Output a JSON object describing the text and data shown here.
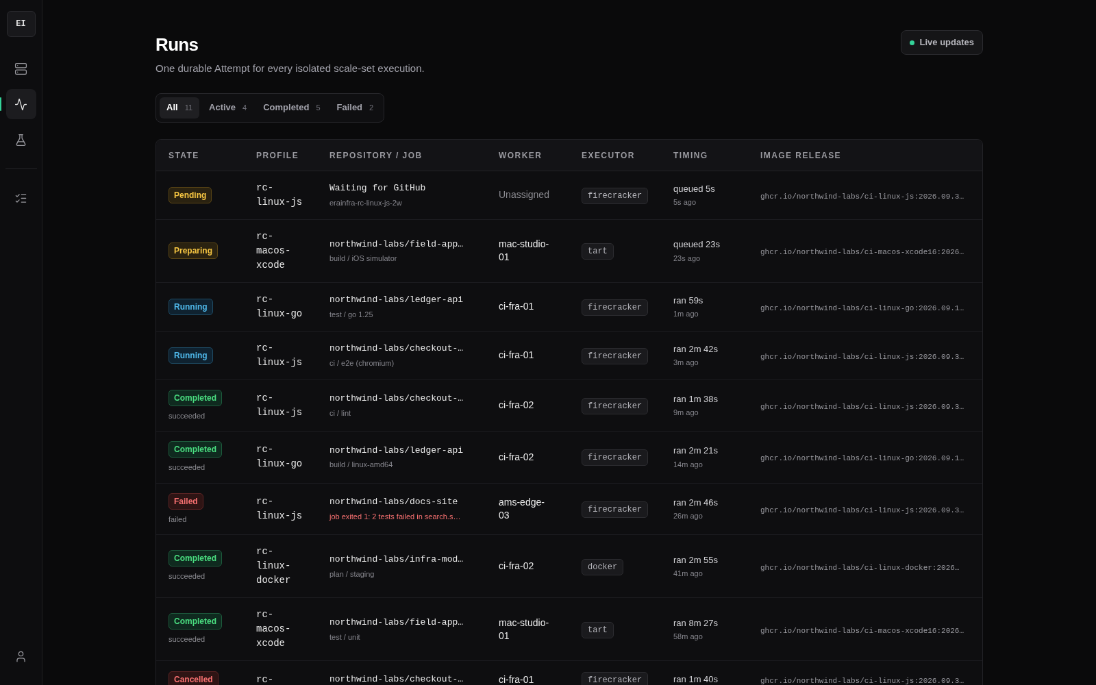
{
  "sidebar": {
    "logo": "EI",
    "items": [
      {
        "selected": false
      },
      {
        "selected": true
      },
      {
        "selected": false
      },
      {
        "selected": false
      }
    ]
  },
  "header": {
    "title": "Runs",
    "subtitle": "One durable Attempt for every isolated scale-set execution.",
    "live": {
      "label": "Live updates",
      "color": "#34d399"
    }
  },
  "filters": [
    {
      "label": "All",
      "count": "11",
      "selected": true
    },
    {
      "label": "Active",
      "count": "4",
      "selected": false
    },
    {
      "label": "Completed",
      "count": "5",
      "selected": false
    },
    {
      "label": "Failed",
      "count": "2",
      "selected": false
    }
  ],
  "table": {
    "columns": [
      "STATE",
      "PROFILE",
      "REPOSITORY / JOB",
      "WORKER",
      "EXECUTOR",
      "TIMING",
      "IMAGE RELEASE"
    ],
    "rows": [
      {
        "state": {
          "label": "Pending",
          "kind": "pending"
        },
        "profile": "rc-linux-js",
        "repo": "Waiting for GitHub",
        "job": "erainfra-rc-linux-js-2w",
        "job_error": false,
        "worker": "Unassigned",
        "assigned": false,
        "executor": "firecracker",
        "timing": "queued 5s",
        "ago": "5s ago",
        "image": "ghcr.io/northwind-labs/ci-linux-js:2026.09.3…"
      },
      {
        "state": {
          "label": "Preparing",
          "kind": "pending"
        },
        "profile": "rc-macos-xcode",
        "repo": "northwind-labs/field-app…",
        "job": "build / iOS simulator",
        "job_error": false,
        "worker": "mac-studio-01",
        "assigned": true,
        "executor": "tart",
        "timing": "queued 23s",
        "ago": "23s ago",
        "image": "ghcr.io/northwind-labs/ci-macos-xcode16:2026…"
      },
      {
        "state": {
          "label": "Running",
          "kind": "running"
        },
        "profile": "rc-linux-go",
        "repo": "northwind-labs/ledger-api",
        "job": "test / go 1.25",
        "job_error": false,
        "worker": "ci-fra-01",
        "assigned": true,
        "executor": "firecracker",
        "timing": "ran 59s",
        "ago": "1m ago",
        "image": "ghcr.io/northwind-labs/ci-linux-go:2026.09.1…"
      },
      {
        "state": {
          "label": "Running",
          "kind": "running"
        },
        "profile": "rc-linux-js",
        "repo": "northwind-labs/checkout-…",
        "job": "ci / e2e (chromium)",
        "job_error": false,
        "worker": "ci-fra-01",
        "assigned": true,
        "executor": "firecracker",
        "timing": "ran 2m 42s",
        "ago": "3m ago",
        "image": "ghcr.io/northwind-labs/ci-linux-js:2026.09.3…"
      },
      {
        "state": {
          "label": "Completed",
          "kind": "success",
          "outcome": "succeeded"
        },
        "profile": "rc-linux-js",
        "repo": "northwind-labs/checkout-…",
        "job": "ci / lint",
        "job_error": false,
        "worker": "ci-fra-02",
        "assigned": true,
        "executor": "firecracker",
        "timing": "ran 1m 38s",
        "ago": "9m ago",
        "image": "ghcr.io/northwind-labs/ci-linux-js:2026.09.3…"
      },
      {
        "state": {
          "label": "Completed",
          "kind": "success",
          "outcome": "succeeded"
        },
        "profile": "rc-linux-go",
        "repo": "northwind-labs/ledger-api",
        "job": "build / linux-amd64",
        "job_error": false,
        "worker": "ci-fra-02",
        "assigned": true,
        "executor": "firecracker",
        "timing": "ran 2m 21s",
        "ago": "14m ago",
        "image": "ghcr.io/northwind-labs/ci-linux-go:2026.09.1…"
      },
      {
        "state": {
          "label": "Failed",
          "kind": "failed",
          "outcome": "failed"
        },
        "profile": "rc-linux-js",
        "repo": "northwind-labs/docs-site",
        "job": "job exited 1: 2 tests failed in search.s…",
        "job_error": true,
        "worker": "ams-edge-03",
        "assigned": true,
        "executor": "firecracker",
        "timing": "ran 2m 46s",
        "ago": "26m ago",
        "image": "ghcr.io/northwind-labs/ci-linux-js:2026.09.3…"
      },
      {
        "state": {
          "label": "Completed",
          "kind": "success",
          "outcome": "succeeded"
        },
        "profile": "rc-linux-docker",
        "repo": "northwind-labs/infra-mod…",
        "job": "plan / staging",
        "job_error": false,
        "worker": "ci-fra-02",
        "assigned": true,
        "executor": "docker",
        "timing": "ran 2m 55s",
        "ago": "41m ago",
        "image": "ghcr.io/northwind-labs/ci-linux-docker:2026…"
      },
      {
        "state": {
          "label": "Completed",
          "kind": "success",
          "outcome": "succeeded"
        },
        "profile": "rc-macos-xcode",
        "repo": "northwind-labs/field-app…",
        "job": "test / unit",
        "job_error": false,
        "worker": "mac-studio-01",
        "assigned": true,
        "executor": "tart",
        "timing": "ran 8m 27s",
        "ago": "58m ago",
        "image": "ghcr.io/northwind-labs/ci-macos-xcode16:2026…"
      },
      {
        "state": {
          "label": "Cancelled",
          "kind": "failed"
        },
        "profile": "rc-",
        "repo": "northwind-labs/checkout-…",
        "worker": "ci-fra-01",
        "assigned": true,
        "executor": "firecracker",
        "timing": "ran 1m 40s",
        "image": "ghcr.io/northwind-labs/ci-linux-js:2026.09.3…"
      }
    ]
  }
}
